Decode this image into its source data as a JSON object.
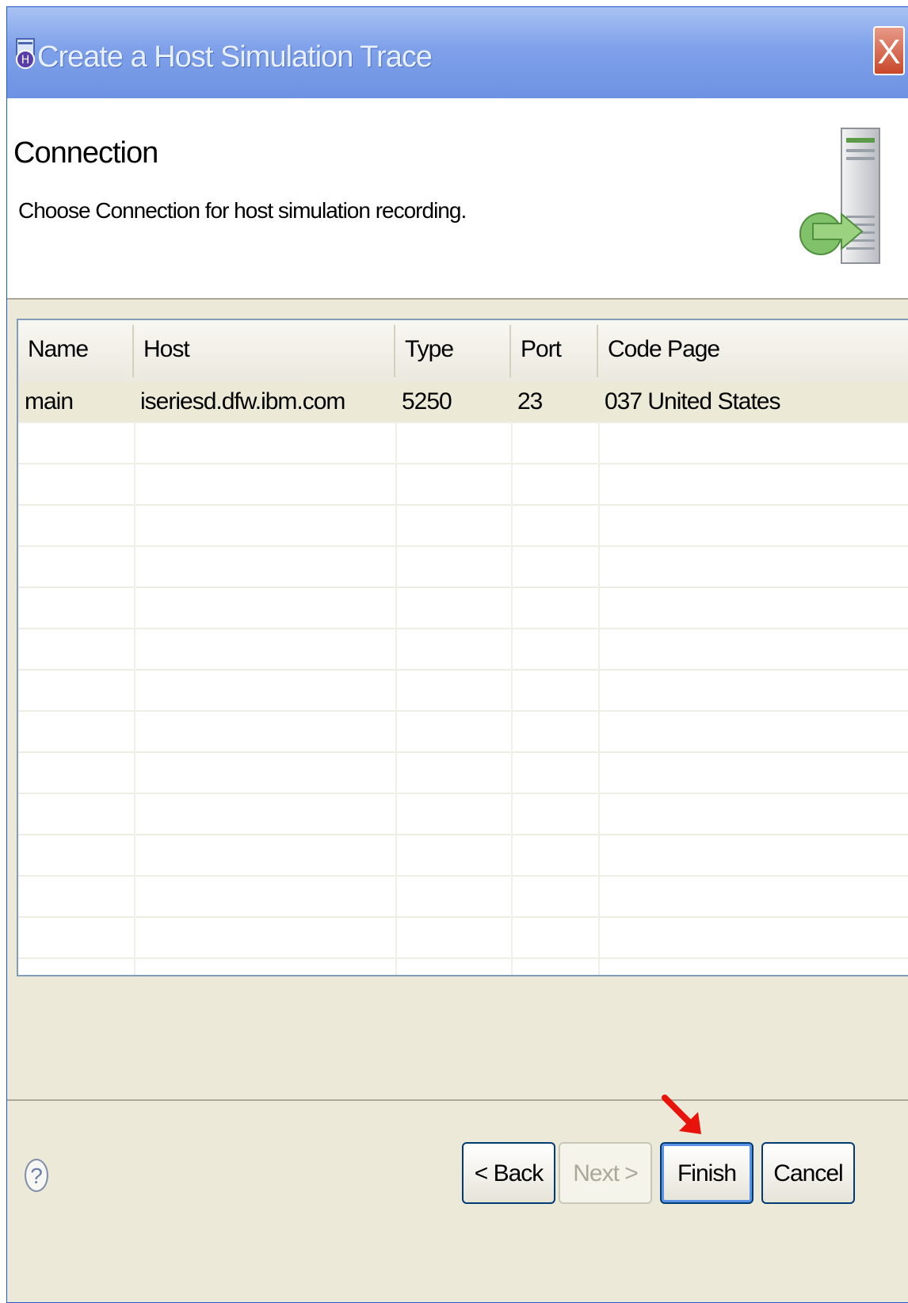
{
  "window": {
    "title": "Create a Host Simulation Trace",
    "close_label": "X"
  },
  "banner": {
    "title": "Connection",
    "description": "Choose Connection for host simulation recording."
  },
  "table": {
    "columns": [
      "Name",
      "Host",
      "Type",
      "Port",
      "Code Page"
    ],
    "rows": [
      [
        "main",
        "iseriesd.dfw.ibm.com",
        "5250",
        "23",
        "037 United States"
      ]
    ]
  },
  "footer": {
    "help_label": "?",
    "back_label": "< Back",
    "next_label": "Next >",
    "finish_label": "Finish",
    "cancel_label": "Cancel"
  },
  "colors": {
    "titlebar": "#7fa1ea",
    "selected_row": "#ecead6",
    "annotation_arrow": "#e8140c"
  }
}
